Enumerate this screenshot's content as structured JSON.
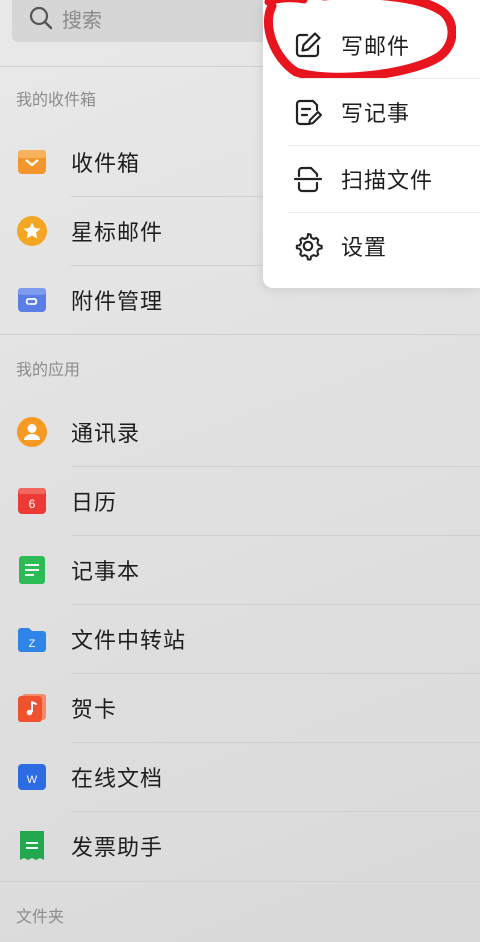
{
  "search": {
    "placeholder": "搜索"
  },
  "inbox_section": {
    "header": "我的收件箱",
    "items": [
      {
        "label": "收件箱",
        "icon": "inbox-icon",
        "color": "#f5962c"
      },
      {
        "label": "星标邮件",
        "icon": "star-icon",
        "color": "#f5a623"
      },
      {
        "label": "附件管理",
        "icon": "attachment-icon",
        "color": "#5b7ee6"
      }
    ]
  },
  "apps_section": {
    "header": "我的应用",
    "items": [
      {
        "label": "通讯录",
        "icon": "contacts-icon",
        "color": "#f59a23"
      },
      {
        "label": "日历",
        "icon": "calendar-icon",
        "color": "#ec3b34",
        "badge": "6"
      },
      {
        "label": "记事本",
        "icon": "notepad-icon",
        "color": "#2dbb55"
      },
      {
        "label": "文件中转站",
        "icon": "file-transfer-icon",
        "color": "#2f84e8",
        "badge": "Z"
      },
      {
        "label": "贺卡",
        "icon": "greeting-card-icon",
        "color": "#f0522f"
      },
      {
        "label": "在线文档",
        "icon": "online-doc-icon",
        "color": "#2d6be3",
        "badge": "W"
      },
      {
        "label": "发票助手",
        "icon": "invoice-icon",
        "color": "#23a850"
      }
    ]
  },
  "folders_section": {
    "header": "文件夹"
  },
  "popup_menu": {
    "items": [
      {
        "label": "写邮件",
        "icon": "compose-icon"
      },
      {
        "label": "写记事",
        "icon": "write-note-icon"
      },
      {
        "label": "扫描文件",
        "icon": "scan-icon"
      },
      {
        "label": "设置",
        "icon": "gear-icon"
      }
    ]
  },
  "colors": {
    "highlight_circle": "#e8141e",
    "background": "#e4e4e4"
  }
}
